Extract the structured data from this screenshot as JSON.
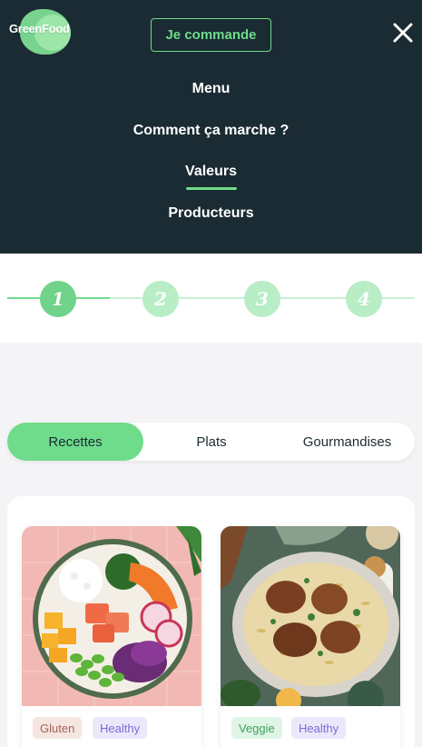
{
  "header": {
    "logo_text": "GreenFood",
    "cta_label": "Je commande"
  },
  "nav": {
    "items": [
      {
        "label": "Menu"
      },
      {
        "label": "Comment ça marche ?"
      },
      {
        "label": "Valeurs",
        "active": true
      },
      {
        "label": "Producteurs"
      }
    ]
  },
  "stepper": {
    "steps": [
      "1",
      "2",
      "3",
      "4"
    ],
    "current": 1
  },
  "tabs": [
    {
      "label": "Recettes",
      "active": true
    },
    {
      "label": "Plats"
    },
    {
      "label": "Gourmandises"
    }
  ],
  "cards": [
    {
      "tags": [
        "Gluten",
        "Healthy"
      ],
      "image": "poke-bowl"
    },
    {
      "tags": [
        "Veggie",
        "Healthy"
      ],
      "image": "chicken-orzo-skillet"
    }
  ],
  "colors": {
    "nav_bg": "#1b2b33",
    "accent": "#6fdc8c",
    "step_inactive": "#b8edc5",
    "page_bg": "#f4f4f6"
  }
}
